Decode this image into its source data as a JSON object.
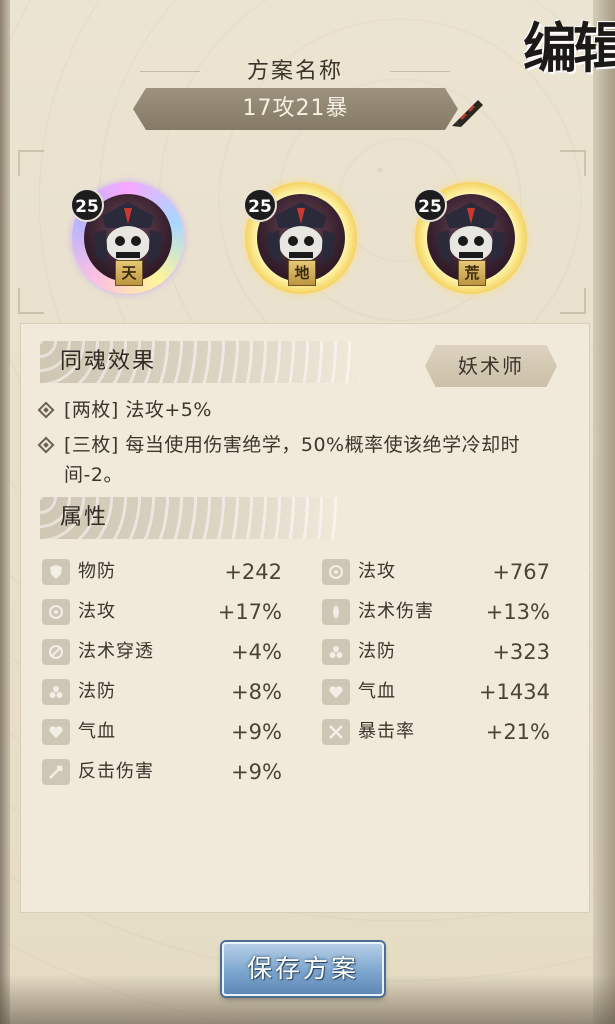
{
  "header": {
    "corner_title": "编辑"
  },
  "plan": {
    "label": "方案名称",
    "name": "17攻21暴",
    "edit_icon": "pen-icon"
  },
  "souls": [
    {
      "level": "25",
      "tag": "天"
    },
    {
      "level": "25",
      "tag": "地"
    },
    {
      "level": "25",
      "tag": "荒"
    }
  ],
  "set_effect": {
    "title": "同魂效果",
    "class_badge": "妖术师",
    "lines": [
      "[两枚] 法攻+5%",
      "[三枚] 每当使用伤害绝学，50%概率使该绝学冷却时间-2。"
    ]
  },
  "attributes": {
    "title": "属性",
    "left": [
      {
        "icon": "shield-icon",
        "name": "物防",
        "value": "+242"
      },
      {
        "icon": "magic-attack-icon",
        "name": "法攻",
        "value": "+17%"
      },
      {
        "icon": "penetration-icon",
        "name": "法术穿透",
        "value": "+4%"
      },
      {
        "icon": "magic-defense-icon",
        "name": "法防",
        "value": "+8%"
      },
      {
        "icon": "heart-icon",
        "name": "气血",
        "value": "+9%"
      },
      {
        "icon": "counter-icon",
        "name": "反击伤害",
        "value": "+9%"
      }
    ],
    "right": [
      {
        "icon": "magic-attack-icon",
        "name": "法攻",
        "value": "+767"
      },
      {
        "icon": "spell-damage-icon",
        "name": "法术伤害",
        "value": "+13%"
      },
      {
        "icon": "magic-defense-icon",
        "name": "法防",
        "value": "+323"
      },
      {
        "icon": "heart-icon",
        "name": "气血",
        "value": "+1434"
      },
      {
        "icon": "crit-icon",
        "name": "暴击率",
        "value": "+21%"
      }
    ]
  },
  "footer": {
    "save_label": "保存方案"
  }
}
